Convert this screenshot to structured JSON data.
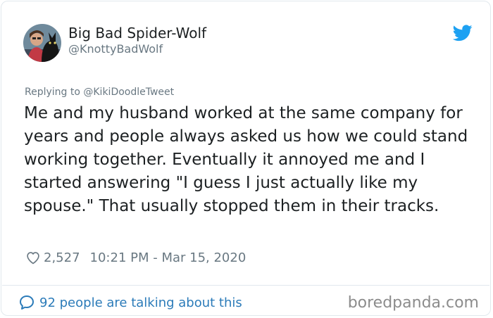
{
  "author": {
    "display_name": "Big Bad Spider-Wolf",
    "handle": "@KnottyBadWolf"
  },
  "reply": {
    "text": "Replying to @KikiDoodleTweet"
  },
  "tweet": {
    "text": "Me and my husband worked at the same company for years and people always asked us how we could stand working together. Eventually it annoyed me and I started answering \"I guess I just actually like my spouse.\" That usually stopped them in their tracks."
  },
  "meta": {
    "likes": "2,527",
    "timestamp": "10:21 PM - Mar 15, 2020"
  },
  "footer": {
    "talking": "92 people are talking about this",
    "watermark": "boredpanda.com"
  },
  "icons": {
    "brand": "twitter-bird-icon",
    "like": "heart-icon",
    "conversation": "speech-bubble-icon"
  },
  "colors": {
    "twitter_blue": "#1da1f2",
    "link_blue": "#2b7bb9",
    "secondary_text": "#697882",
    "primary_text": "#1c2022",
    "border": "#e1e8ed"
  }
}
